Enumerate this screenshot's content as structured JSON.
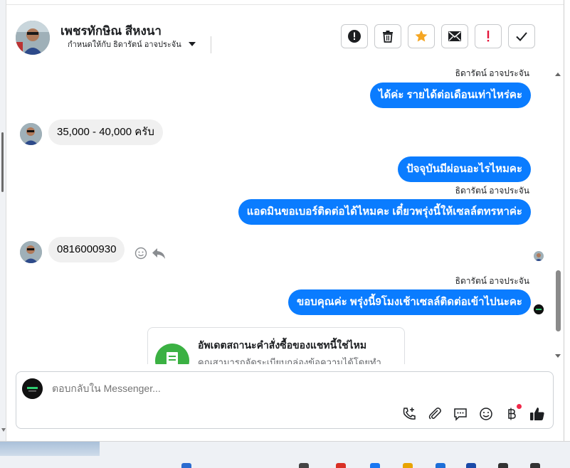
{
  "header": {
    "contact_name": "เพชรทักษิณ สีหงนา",
    "assigned_to": "กำหนดให้กับ ธิดารัตน์ อาจประจัน"
  },
  "actions": [
    {
      "name": "report-spam-button",
      "icon": "alert-circle-icon",
      "glyph": "!"
    },
    {
      "name": "delete-button",
      "icon": "trash-icon",
      "glyph": ""
    },
    {
      "name": "star-button",
      "icon": "star-icon",
      "glyph": "★"
    },
    {
      "name": "mark-unread-button",
      "icon": "envelope-icon",
      "glyph": ""
    },
    {
      "name": "follow-up-button",
      "icon": "exclamation-icon",
      "glyph": "!"
    },
    {
      "name": "done-button",
      "icon": "check-icon",
      "glyph": "✓"
    }
  ],
  "messages": {
    "sender_top": "ธิดารัตน์ อาจประจัน",
    "out_1": "ได้ค่ะ รายได้ต่อเดือนเท่าไหร่คะ",
    "in_1": "35,000 - 40,000 ครับ",
    "out_2": "ปัจจุบันมีผ่อนอะไรไหมคะ",
    "sender_2": "ธิดารัตน์ อาจประจัน",
    "out_3": "แอดมินขอเบอร์ติดต่อได้ไหมคะ เดี๋ยวพรุ่งนี้ให้เซลล์ตทรหาค่ะ",
    "in_2": "0816000930",
    "sender_3": "ธิดารัตน์ อาจประจัน",
    "out_4": "ขอบคุณค่ะ พรุ่งนี้9โมงเช้าเซลล์ติดต่อเข้าไปนะคะ"
  },
  "order_card": {
    "title": "อัพเดตสถานะคำสั่งซื้อของแชทนี้ใช่ไหม",
    "subtitle": "คุณสามารถจัดระเบียบกล่องข้อความได้โดยทำ"
  },
  "composer": {
    "placeholder": "ตอบกลับใน Messenger..."
  },
  "colors": {
    "outgoing_bubble": "#0a7cff",
    "incoming_bubble": "#f0f0f0",
    "star": "#f5a623",
    "alert_red": "#e4163a",
    "order_icon": "#3bb143"
  }
}
